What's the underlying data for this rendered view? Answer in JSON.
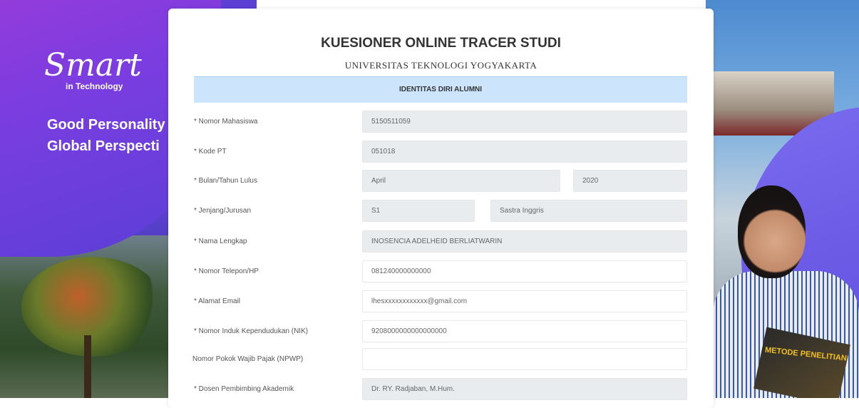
{
  "brand": {
    "script": "Smart",
    "sub": "in Technology",
    "tagline_1": "Good Personality",
    "tagline_2": "Global Perspecti"
  },
  "book": {
    "text": "METODE PENELITIAN"
  },
  "form": {
    "title": "KUESIONER ONLINE TRACER STUDI",
    "subtitle": "UNIVERSITAS TEKNOLOGI YOGYAKARTA",
    "section": "IDENTITAS DIRI ALUMNI",
    "fields": {
      "nomor_mahasiswa": {
        "label": "* Nomor Mahasiswa",
        "value": "5150511059"
      },
      "kode_pt": {
        "label": "* Kode PT",
        "value": "051018"
      },
      "bulan_tahun_lulus": {
        "label": "* Bulan/Tahun Lulus",
        "month": "April",
        "year": "2020"
      },
      "jenjang_jurusan": {
        "label": "* Jenjang/Jurusan",
        "jenjang": "S1",
        "jurusan": "Sastra Inggris"
      },
      "nama_lengkap": {
        "label": "* Nama Lengkap",
        "value": "INOSENCIA ADELHEID BERLIATWARIN"
      },
      "nomor_telepon": {
        "label": "* Nomor Telepon/HP",
        "value": "081240000000000"
      },
      "alamat_email": {
        "label": "* Alamat Email",
        "value": "lhesxxxxxxxxxxxx@gmail.com"
      },
      "nik": {
        "label": "* Nomor Induk Kependudukan (NIK)",
        "value": "9208000000000000000"
      },
      "npwp": {
        "label": "Nomor Pokok Wajib Pajak (NPWP)",
        "value": ""
      },
      "dosen_pembimbing": {
        "label": "* Dosen Pembimbing Akademik",
        "value": "Dr. RY. Radjaban, M.Hum."
      }
    }
  }
}
